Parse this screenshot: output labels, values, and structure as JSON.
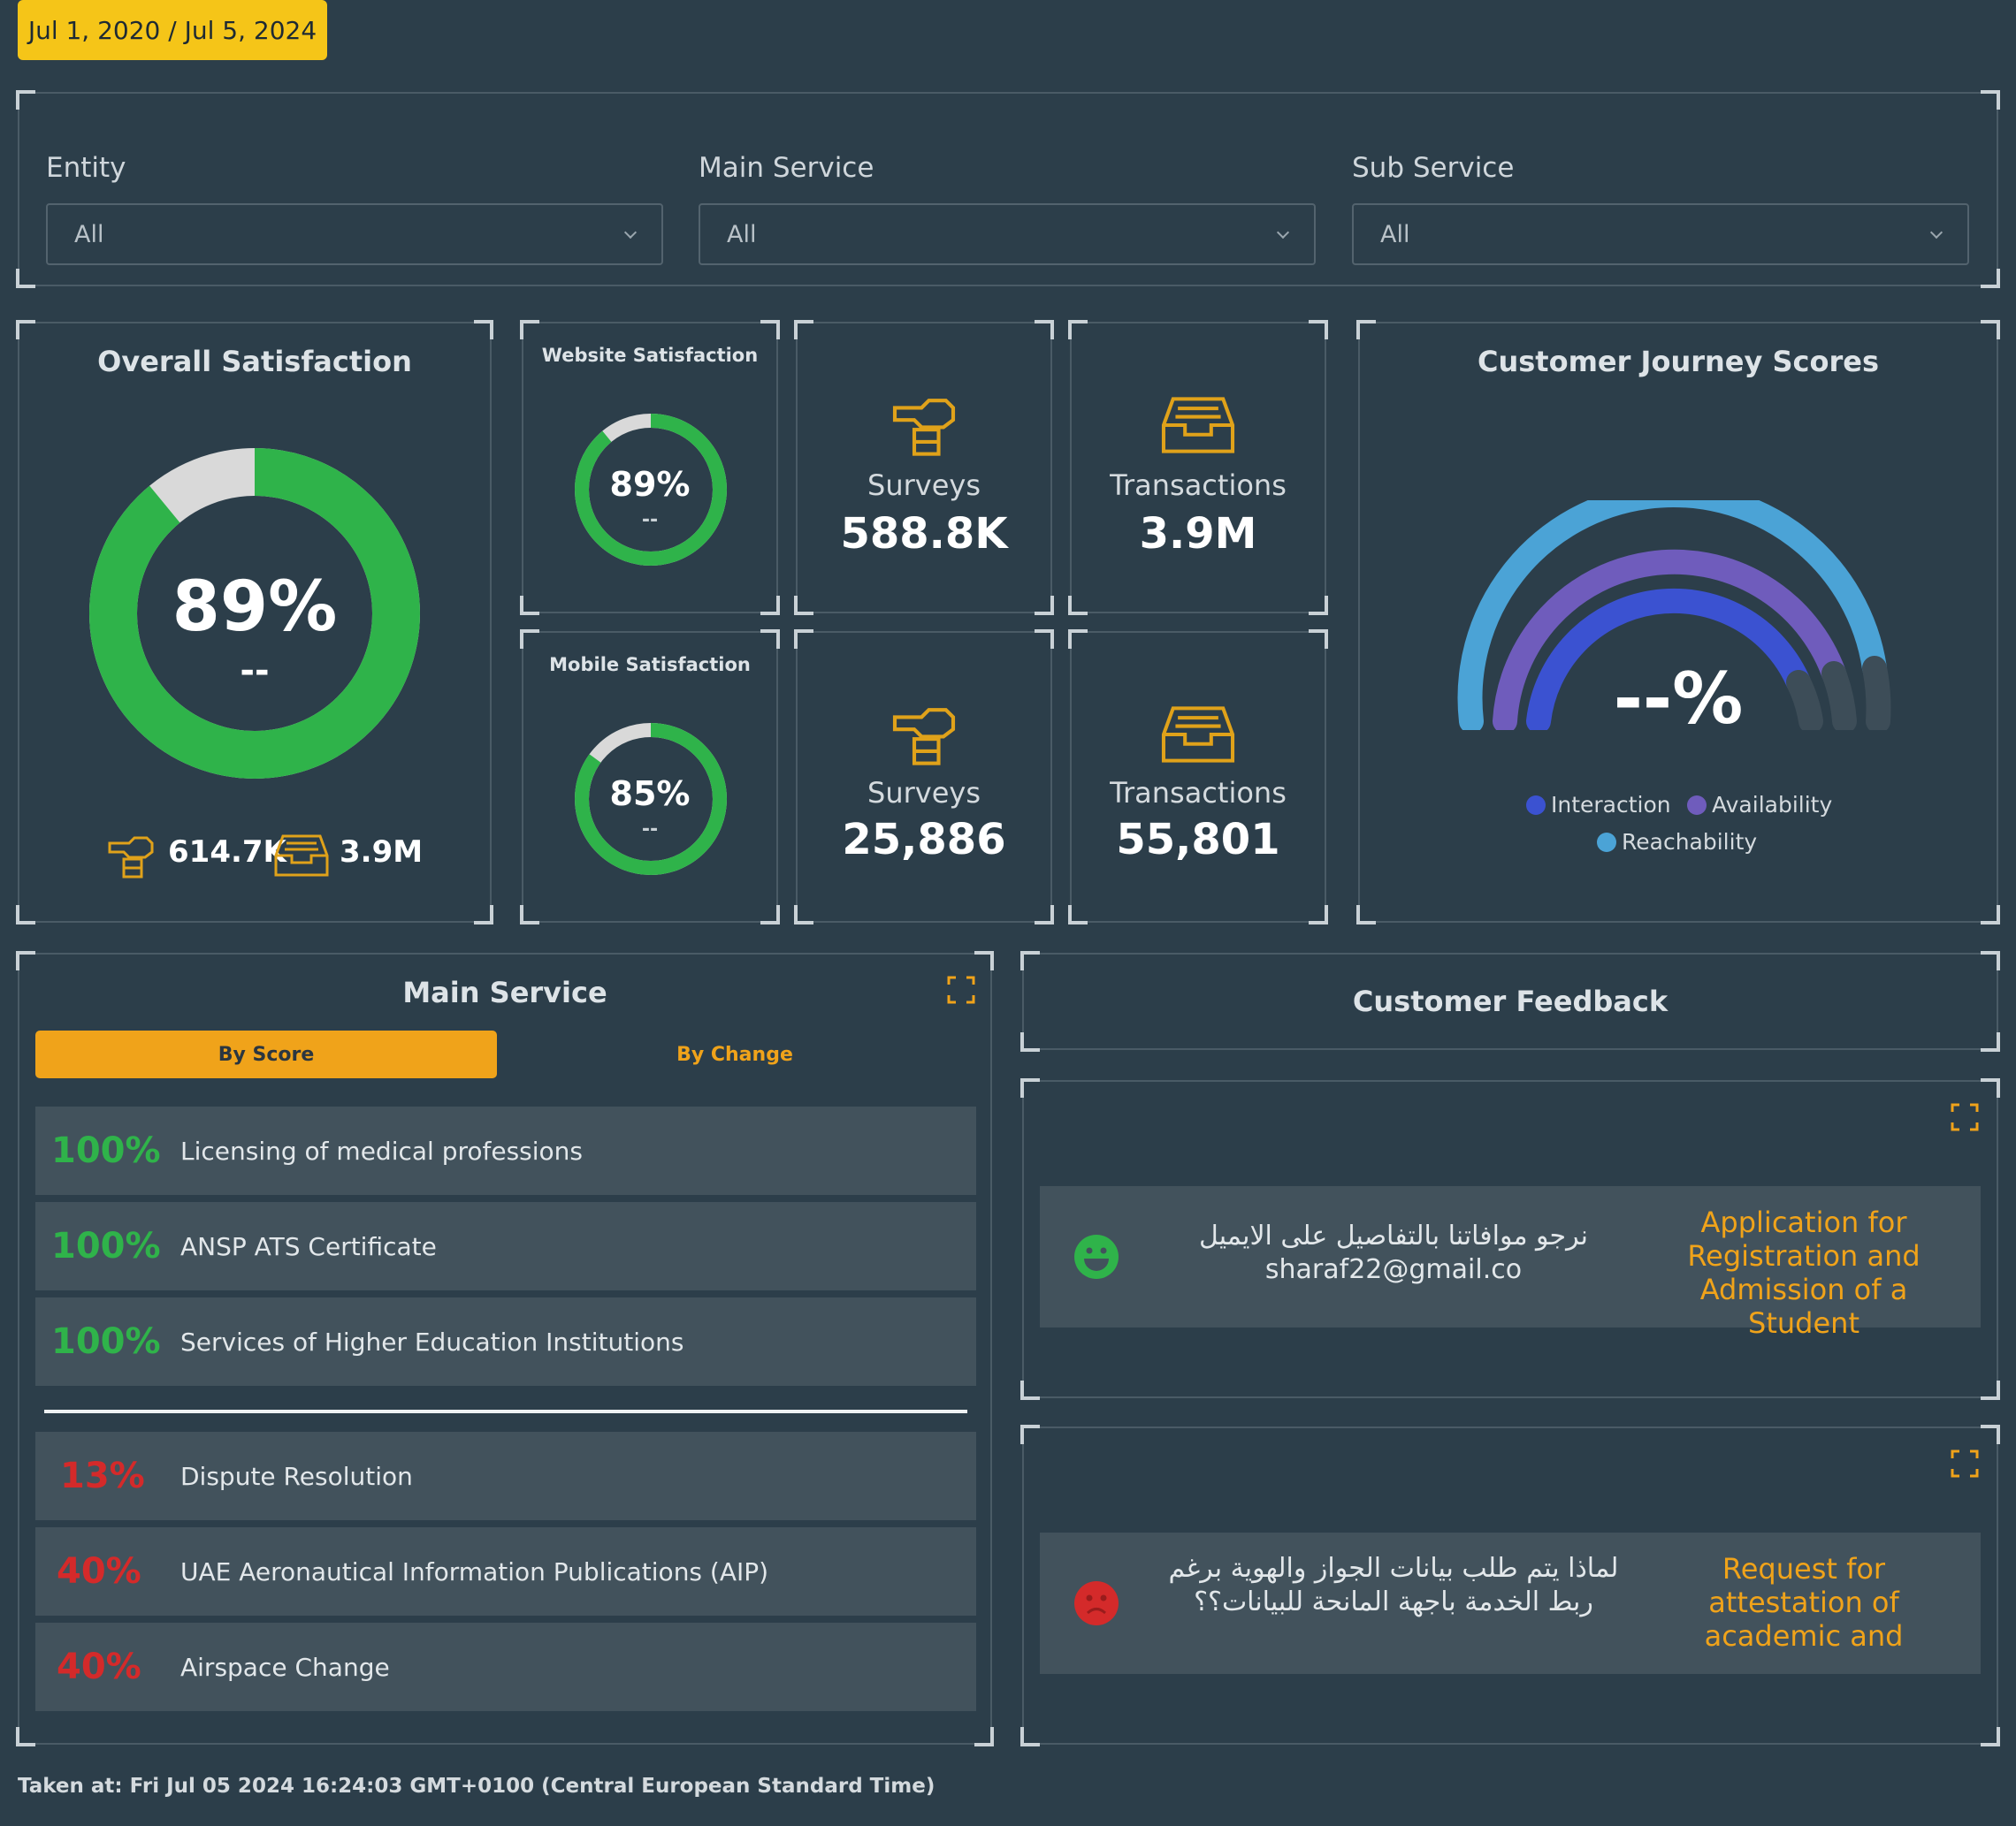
{
  "date_range": "Jul 1, 2020 / Jul 5, 2024",
  "filters": [
    {
      "label": "Entity",
      "value": "All"
    },
    {
      "label": "Main Service",
      "value": "All"
    },
    {
      "label": "Sub Service",
      "value": "All"
    }
  ],
  "overall": {
    "title": "Overall Satisfaction",
    "percent": "89%",
    "percent_value": 89,
    "change": "--",
    "surveys": "614.7K",
    "transactions": "3.9M"
  },
  "website": {
    "title": "Website Satisfaction",
    "percent": "89%",
    "percent_value": 89,
    "change": "--"
  },
  "mobile": {
    "title": "Mobile Satisfaction",
    "percent": "85%",
    "percent_value": 85,
    "change": "--"
  },
  "kpis": {
    "web_surveys": {
      "label": "Surveys",
      "value": "588.8K"
    },
    "web_transactions": {
      "label": "Transactions",
      "value": "3.9M"
    },
    "mob_surveys": {
      "label": "Surveys",
      "value": "25,886"
    },
    "mob_transactions": {
      "label": "Transactions",
      "value": "55,801"
    }
  },
  "journey": {
    "title": "Customer Journey Scores",
    "value": "--%",
    "legend": [
      {
        "label": "Interaction",
        "color": "#3b52d1"
      },
      {
        "label": "Availability",
        "color": "#6f5cbc"
      },
      {
        "label": "Reachability",
        "color": "#4ba3d6"
      }
    ]
  },
  "main_service": {
    "title": "Main Service",
    "tabs": [
      "By Score",
      "By Change"
    ],
    "top": [
      {
        "pct": "100%",
        "name": "Licensing of medical professions"
      },
      {
        "pct": "100%",
        "name": "ANSP ATS Certificate"
      },
      {
        "pct": "100%",
        "name": "Services of Higher Education Institutions"
      }
    ],
    "bottom": [
      {
        "pct": "13%",
        "name": "Dispute Resolution"
      },
      {
        "pct": "40%",
        "name": "UAE Aeronautical Information Publications (AIP)"
      },
      {
        "pct": "40%",
        "name": "Airspace Change"
      }
    ]
  },
  "feedback": {
    "title": "Customer Feedback",
    "items": [
      {
        "sentiment": "positive",
        "text": "نرجو موافاتنا بالتفاصيل على الايميل sharaf22@gmail.co",
        "service": "Application for Registration and Admission of a Student"
      },
      {
        "sentiment": "negative",
        "text": "لماذا يتم طلب بيانات الجواز والهوية برغم ربط الخدمة باجهة المانحة للبيانات؟؟",
        "service": "Request for attestation of academic and"
      }
    ]
  },
  "footer": "Taken at: Fri Jul 05 2024 16:24:03 GMT+0100 (Central European Standard Time)",
  "colors": {
    "accent": "#f0a31a",
    "good": "#2fb34a",
    "bad": "#d42a2a",
    "track": "#d9d9d9"
  }
}
